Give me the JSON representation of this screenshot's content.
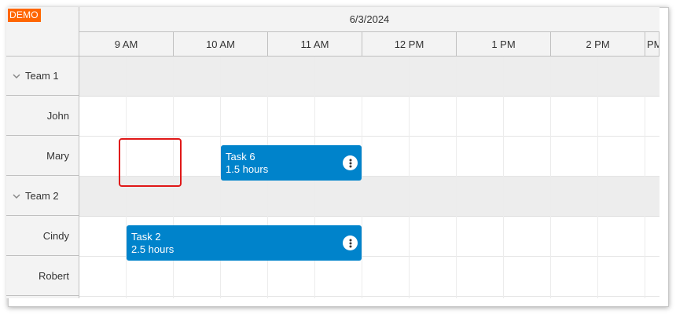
{
  "demo_badge": "DEMO",
  "header": {
    "date": "6/3/2024",
    "hours": [
      "9 AM",
      "10 AM",
      "11 AM",
      "12 PM",
      "1 PM",
      "2 PM",
      "PM"
    ]
  },
  "rows": [
    {
      "type": "group",
      "label": "Team 1"
    },
    {
      "type": "resource",
      "label": "John"
    },
    {
      "type": "resource",
      "label": "Mary"
    },
    {
      "type": "group",
      "label": "Team 2"
    },
    {
      "type": "resource",
      "label": "Cindy"
    },
    {
      "type": "resource",
      "label": "Robert"
    }
  ],
  "events": [
    {
      "title": "Task 6",
      "duration": "1.5 hours",
      "resource": "Mary",
      "start": "10:30 AM",
      "end": "12:00 PM"
    },
    {
      "title": "Task 2",
      "duration": "2.5 hours",
      "resource": "Cindy",
      "start": "9:30 AM",
      "end": "12:00 PM"
    }
  ],
  "selection": {
    "resource": "Mary",
    "start": "9:00 AM",
    "end": "10:00 AM"
  },
  "colors": {
    "event": "#0083cb",
    "demo": "#ff6600",
    "selection": "#e01818",
    "group_row": "#ededed"
  }
}
